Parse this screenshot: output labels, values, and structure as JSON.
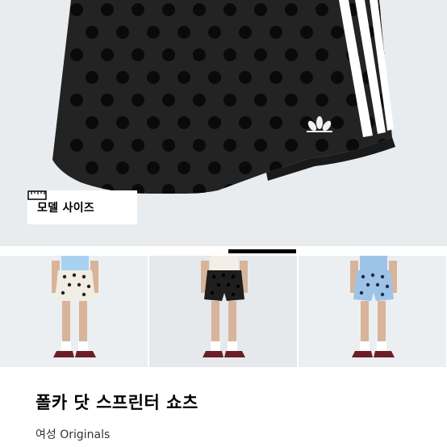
{
  "hero": {
    "image": "polka-dot-shorts-closeup",
    "background": "#e9ecef",
    "shorts_color": "#232323",
    "dot_color": "#0a0a0a",
    "stripe_color": "#ffffff"
  },
  "model_size": {
    "label": "모델 사이즈",
    "icon": "ruler-icon"
  },
  "carousel": {
    "active_index": 1,
    "count": 3
  },
  "thumbnails": [
    {
      "name": "cream-polka-shorts-thumb",
      "shorts_color": "#f1ede2",
      "dot_color": "#222222",
      "top_color": "#a9d2f0"
    },
    {
      "name": "black-polka-shorts-thumb",
      "shorts_color": "#1e1e1e",
      "dot_color": "#000000",
      "top_color": "#f3efe6"
    },
    {
      "name": "blue-polka-shorts-thumb",
      "shorts_color": "#9ec3e8",
      "dot_color": "#1f2b44",
      "top_color": "#9ec3e8"
    }
  ],
  "product": {
    "title": "폴카 닷 스프린터 쇼츠",
    "subtitle": "여성 Originals"
  }
}
